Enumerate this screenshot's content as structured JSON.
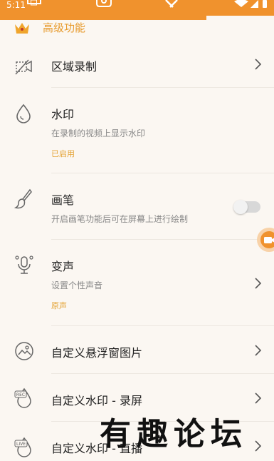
{
  "status_bar": {
    "time": "5:11"
  },
  "section": {
    "title": "高级功能"
  },
  "items": [
    {
      "title": "区域录制"
    },
    {
      "title": "水印",
      "subtitle": "在录制的视频上显示水印",
      "status": "已启用"
    },
    {
      "title": "画笔",
      "subtitle": "开启画笔功能后可在屏幕上进行绘制",
      "toggle_on": false
    },
    {
      "title": "变声",
      "subtitle": "设置个性声音",
      "status": "原声"
    },
    {
      "title": "自定义悬浮窗图片"
    },
    {
      "title": "自定义水印 - 录屏",
      "icon_badge": "REC"
    },
    {
      "title": "自定义水印 - 直播",
      "icon_badge": "LIVE"
    }
  ],
  "watermark": {
    "text": "有趣论坛"
  },
  "colors": {
    "accent": "#f0922d",
    "status_text": "#e4a437",
    "background": "#fbf7f2"
  }
}
